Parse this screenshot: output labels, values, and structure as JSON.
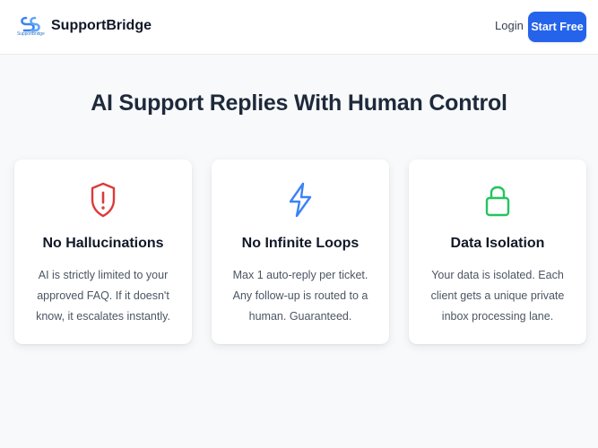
{
  "navbar": {
    "logo_caption": "SupportBridge",
    "brand": "SupportBridge",
    "login": "Login",
    "cta": "Start Free"
  },
  "hero": {
    "headline": "AI Support Replies With Human Control"
  },
  "features": [
    {
      "icon": "shield-alert-icon",
      "color": "#dc3b3b",
      "title": "No Hallucinations",
      "body": "AI is strictly limited to your approved FAQ. If it doesn't know, it escalates instantly."
    },
    {
      "icon": "lightning-icon",
      "color": "#3b82f6",
      "title": "No Infinite Loops",
      "body": "Max 1 auto-reply per ticket. Any follow-up is routed to a human. Guaranteed."
    },
    {
      "icon": "lock-icon",
      "color": "#22c55e",
      "title": "Data Isolation",
      "body": "Your data is isolated. Each client gets a unique private inbox processing lane."
    }
  ],
  "colors": {
    "accent": "#2563eb",
    "background": "#f8f9fb"
  }
}
